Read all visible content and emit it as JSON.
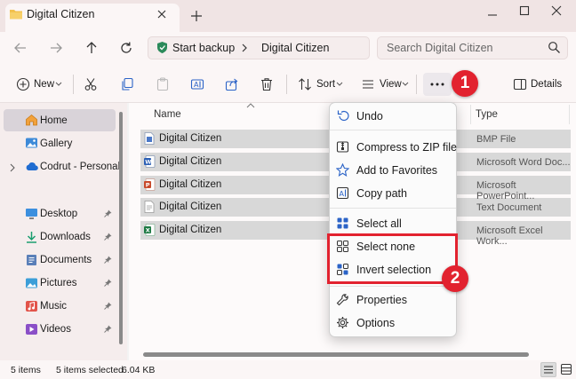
{
  "window": {
    "tab_title": "Digital Citizen"
  },
  "address": {
    "root": "Start backup",
    "current": "Digital Citizen"
  },
  "search": {
    "placeholder": "Search Digital Citizen"
  },
  "toolbar": {
    "new_label": "New",
    "sort_label": "Sort",
    "view_label": "View",
    "details_label": "Details"
  },
  "nav": {
    "items": [
      {
        "label": "Home",
        "icon": "home-icon"
      },
      {
        "label": "Gallery",
        "icon": "gallery-icon"
      },
      {
        "label": "Codrut - Personal",
        "icon": "cloud-icon"
      },
      {
        "label": "Desktop",
        "icon": "desktop-icon"
      },
      {
        "label": "Downloads",
        "icon": "download-icon"
      },
      {
        "label": "Documents",
        "icon": "documents-icon"
      },
      {
        "label": "Pictures",
        "icon": "pictures-icon"
      },
      {
        "label": "Music",
        "icon": "music-icon"
      },
      {
        "label": "Videos",
        "icon": "videos-icon"
      }
    ]
  },
  "columns": {
    "name": "Name",
    "type": "Type"
  },
  "files": [
    {
      "name": "Digital Citizen",
      "type": "BMP File",
      "icon": "bmp-file-icon",
      "color": "#4a78c8"
    },
    {
      "name": "Digital Citizen",
      "type": "Microsoft Word Doc...",
      "icon": "word-file-icon",
      "color": "#2b5fb5"
    },
    {
      "name": "Digital Citizen",
      "type": "Microsoft PowerPoint...",
      "icon": "powerpoint-file-icon",
      "color": "#c84a2b"
    },
    {
      "name": "Digital Citizen",
      "type": "Text Document",
      "icon": "text-file-icon",
      "color": "#8a8a8a"
    },
    {
      "name": "Digital Citizen",
      "type": "Microsoft Excel Work...",
      "icon": "excel-file-icon",
      "color": "#1e7a44"
    }
  ],
  "menu": {
    "undo": "Undo",
    "compress": "Compress to ZIP file",
    "favorites": "Add to Favorites",
    "copy_path": "Copy path",
    "select_all": "Select all",
    "select_none": "Select none",
    "invert": "Invert selection",
    "properties": "Properties",
    "options": "Options"
  },
  "status": {
    "item_count": "5 items",
    "selected": "5 items selected",
    "size": "6.04 KB"
  },
  "badges": {
    "first": "1",
    "second": "2"
  },
  "colors": {
    "accent": "#2b63c7",
    "highlight": "#e2222f"
  }
}
